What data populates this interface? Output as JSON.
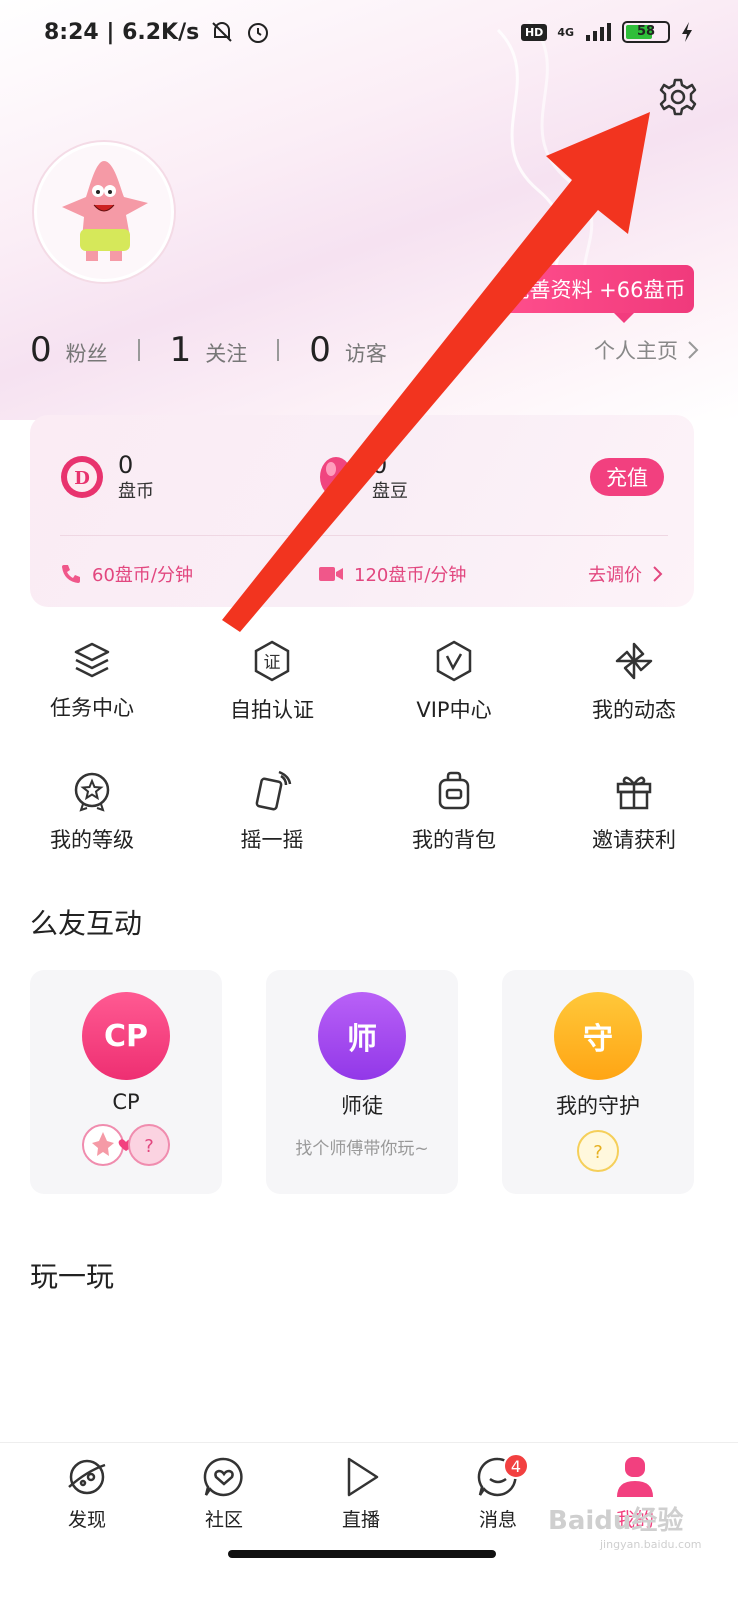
{
  "status_bar": {
    "time_speed": "8:24 | 6.2K/s",
    "network": "4G",
    "hd": "HD",
    "battery": "58"
  },
  "profile": {
    "promo_text": "完善资料 +66盘币",
    "stats": [
      {
        "num": "0",
        "label": "粉丝"
      },
      {
        "num": "1",
        "label": "关注"
      },
      {
        "num": "0",
        "label": "访客"
      }
    ],
    "homepage_link": "个人主页"
  },
  "wallet": {
    "coins_value": "0",
    "coins_label": "盘币",
    "beans_value": "0",
    "beans_label": "盘豆",
    "recharge_label": "充值",
    "voice_price": "60盘币/分钟",
    "video_price": "120盘币/分钟",
    "adjust_label": "去调价"
  },
  "features": [
    {
      "label": "任务中心",
      "icon": "layers-icon"
    },
    {
      "label": "自拍认证",
      "icon": "verify-icon"
    },
    {
      "label": "VIP中心",
      "icon": "vip-icon"
    },
    {
      "label": "我的动态",
      "icon": "pinwheel-icon"
    },
    {
      "label": "我的等级",
      "icon": "level-badge-icon"
    },
    {
      "label": "摇一摇",
      "icon": "shake-icon"
    },
    {
      "label": "我的背包",
      "icon": "backpack-icon"
    },
    {
      "label": "邀请获利",
      "icon": "gift-icon"
    }
  ],
  "interaction_section": {
    "title": "么友互动",
    "cards": [
      {
        "badge": "CP",
        "title": "CP",
        "sub": "",
        "color": "#f23d7e"
      },
      {
        "badge": "师",
        "title": "师徒",
        "sub": "找个师傅带你玩~",
        "color": "#a44cf0"
      },
      {
        "badge": "守",
        "title": "我的守护",
        "sub": "",
        "color": "#ffb020"
      }
    ]
  },
  "play_section": {
    "title": "玩一玩"
  },
  "bottom_nav": {
    "items": [
      {
        "label": "发现",
        "icon": "planet-icon"
      },
      {
        "label": "社区",
        "icon": "heart-chat-icon"
      },
      {
        "label": "直播",
        "icon": "play-icon"
      },
      {
        "label": "消息",
        "icon": "message-icon",
        "badge": "4"
      },
      {
        "label": "我的",
        "icon": "profile-icon"
      }
    ]
  },
  "watermark": {
    "text": "Baidu经验",
    "sub": "jingyan.baidu.com"
  },
  "colors": {
    "accent": "#f2407f",
    "arrow": "#f2341f"
  }
}
